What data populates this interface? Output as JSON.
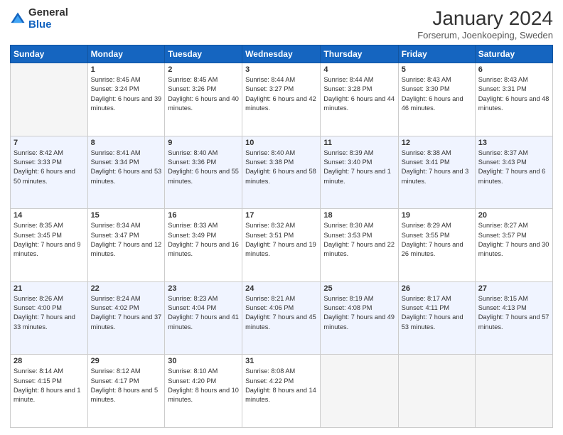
{
  "logo": {
    "general": "General",
    "blue": "Blue"
  },
  "title": "January 2024",
  "subtitle": "Forserum, Joenkoeping, Sweden",
  "days_of_week": [
    "Sunday",
    "Monday",
    "Tuesday",
    "Wednesday",
    "Thursday",
    "Friday",
    "Saturday"
  ],
  "weeks": [
    [
      {
        "num": "",
        "sunrise": "",
        "sunset": "",
        "daylight": "",
        "empty": true
      },
      {
        "num": "1",
        "sunrise": "Sunrise: 8:45 AM",
        "sunset": "Sunset: 3:24 PM",
        "daylight": "Daylight: 6 hours and 39 minutes."
      },
      {
        "num": "2",
        "sunrise": "Sunrise: 8:45 AM",
        "sunset": "Sunset: 3:26 PM",
        "daylight": "Daylight: 6 hours and 40 minutes."
      },
      {
        "num": "3",
        "sunrise": "Sunrise: 8:44 AM",
        "sunset": "Sunset: 3:27 PM",
        "daylight": "Daylight: 6 hours and 42 minutes."
      },
      {
        "num": "4",
        "sunrise": "Sunrise: 8:44 AM",
        "sunset": "Sunset: 3:28 PM",
        "daylight": "Daylight: 6 hours and 44 minutes."
      },
      {
        "num": "5",
        "sunrise": "Sunrise: 8:43 AM",
        "sunset": "Sunset: 3:30 PM",
        "daylight": "Daylight: 6 hours and 46 minutes."
      },
      {
        "num": "6",
        "sunrise": "Sunrise: 8:43 AM",
        "sunset": "Sunset: 3:31 PM",
        "daylight": "Daylight: 6 hours and 48 minutes."
      }
    ],
    [
      {
        "num": "7",
        "sunrise": "Sunrise: 8:42 AM",
        "sunset": "Sunset: 3:33 PM",
        "daylight": "Daylight: 6 hours and 50 minutes."
      },
      {
        "num": "8",
        "sunrise": "Sunrise: 8:41 AM",
        "sunset": "Sunset: 3:34 PM",
        "daylight": "Daylight: 6 hours and 53 minutes."
      },
      {
        "num": "9",
        "sunrise": "Sunrise: 8:40 AM",
        "sunset": "Sunset: 3:36 PM",
        "daylight": "Daylight: 6 hours and 55 minutes."
      },
      {
        "num": "10",
        "sunrise": "Sunrise: 8:40 AM",
        "sunset": "Sunset: 3:38 PM",
        "daylight": "Daylight: 6 hours and 58 minutes."
      },
      {
        "num": "11",
        "sunrise": "Sunrise: 8:39 AM",
        "sunset": "Sunset: 3:40 PM",
        "daylight": "Daylight: 7 hours and 1 minute."
      },
      {
        "num": "12",
        "sunrise": "Sunrise: 8:38 AM",
        "sunset": "Sunset: 3:41 PM",
        "daylight": "Daylight: 7 hours and 3 minutes."
      },
      {
        "num": "13",
        "sunrise": "Sunrise: 8:37 AM",
        "sunset": "Sunset: 3:43 PM",
        "daylight": "Daylight: 7 hours and 6 minutes."
      }
    ],
    [
      {
        "num": "14",
        "sunrise": "Sunrise: 8:35 AM",
        "sunset": "Sunset: 3:45 PM",
        "daylight": "Daylight: 7 hours and 9 minutes."
      },
      {
        "num": "15",
        "sunrise": "Sunrise: 8:34 AM",
        "sunset": "Sunset: 3:47 PM",
        "daylight": "Daylight: 7 hours and 12 minutes."
      },
      {
        "num": "16",
        "sunrise": "Sunrise: 8:33 AM",
        "sunset": "Sunset: 3:49 PM",
        "daylight": "Daylight: 7 hours and 16 minutes."
      },
      {
        "num": "17",
        "sunrise": "Sunrise: 8:32 AM",
        "sunset": "Sunset: 3:51 PM",
        "daylight": "Daylight: 7 hours and 19 minutes."
      },
      {
        "num": "18",
        "sunrise": "Sunrise: 8:30 AM",
        "sunset": "Sunset: 3:53 PM",
        "daylight": "Daylight: 7 hours and 22 minutes."
      },
      {
        "num": "19",
        "sunrise": "Sunrise: 8:29 AM",
        "sunset": "Sunset: 3:55 PM",
        "daylight": "Daylight: 7 hours and 26 minutes."
      },
      {
        "num": "20",
        "sunrise": "Sunrise: 8:27 AM",
        "sunset": "Sunset: 3:57 PM",
        "daylight": "Daylight: 7 hours and 30 minutes."
      }
    ],
    [
      {
        "num": "21",
        "sunrise": "Sunrise: 8:26 AM",
        "sunset": "Sunset: 4:00 PM",
        "daylight": "Daylight: 7 hours and 33 minutes."
      },
      {
        "num": "22",
        "sunrise": "Sunrise: 8:24 AM",
        "sunset": "Sunset: 4:02 PM",
        "daylight": "Daylight: 7 hours and 37 minutes."
      },
      {
        "num": "23",
        "sunrise": "Sunrise: 8:23 AM",
        "sunset": "Sunset: 4:04 PM",
        "daylight": "Daylight: 7 hours and 41 minutes."
      },
      {
        "num": "24",
        "sunrise": "Sunrise: 8:21 AM",
        "sunset": "Sunset: 4:06 PM",
        "daylight": "Daylight: 7 hours and 45 minutes."
      },
      {
        "num": "25",
        "sunrise": "Sunrise: 8:19 AM",
        "sunset": "Sunset: 4:08 PM",
        "daylight": "Daylight: 7 hours and 49 minutes."
      },
      {
        "num": "26",
        "sunrise": "Sunrise: 8:17 AM",
        "sunset": "Sunset: 4:11 PM",
        "daylight": "Daylight: 7 hours and 53 minutes."
      },
      {
        "num": "27",
        "sunrise": "Sunrise: 8:15 AM",
        "sunset": "Sunset: 4:13 PM",
        "daylight": "Daylight: 7 hours and 57 minutes."
      }
    ],
    [
      {
        "num": "28",
        "sunrise": "Sunrise: 8:14 AM",
        "sunset": "Sunset: 4:15 PM",
        "daylight": "Daylight: 8 hours and 1 minute."
      },
      {
        "num": "29",
        "sunrise": "Sunrise: 8:12 AM",
        "sunset": "Sunset: 4:17 PM",
        "daylight": "Daylight: 8 hours and 5 minutes."
      },
      {
        "num": "30",
        "sunrise": "Sunrise: 8:10 AM",
        "sunset": "Sunset: 4:20 PM",
        "daylight": "Daylight: 8 hours and 10 minutes."
      },
      {
        "num": "31",
        "sunrise": "Sunrise: 8:08 AM",
        "sunset": "Sunset: 4:22 PM",
        "daylight": "Daylight: 8 hours and 14 minutes."
      },
      {
        "num": "",
        "sunrise": "",
        "sunset": "",
        "daylight": "",
        "empty": true
      },
      {
        "num": "",
        "sunrise": "",
        "sunset": "",
        "daylight": "",
        "empty": true
      },
      {
        "num": "",
        "sunrise": "",
        "sunset": "",
        "daylight": "",
        "empty": true
      }
    ]
  ]
}
